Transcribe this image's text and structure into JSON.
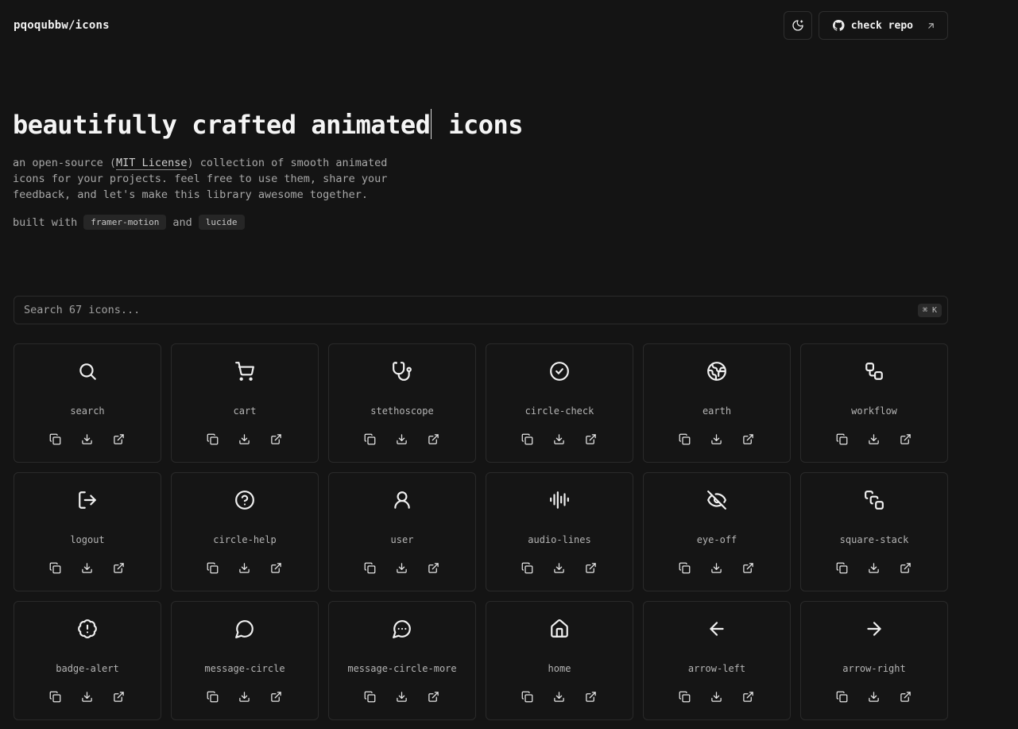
{
  "header": {
    "brand": "pqoqubbw/icons",
    "theme_toggle_icon": "moon-sun-icon",
    "repo_button_label": "check repo"
  },
  "hero": {
    "title_before_caret": "beautifully crafted animated",
    "title_after_caret": " icons",
    "desc_part1": "an open-source (",
    "license_link": "MIT License",
    "desc_part2": ") collection of smooth animated icons for your projects. feel free to use them, share your feedback, and let's make this library awesome together.",
    "built_with_label": "built with",
    "and_label": "and",
    "libraries": [
      "framer-motion",
      "lucide"
    ]
  },
  "search": {
    "placeholder": "Search 67 icons...",
    "shortcut": "⌘ K"
  },
  "icons": [
    {
      "name": "search",
      "icon": "search"
    },
    {
      "name": "cart",
      "icon": "cart"
    },
    {
      "name": "stethoscope",
      "icon": "stethoscope"
    },
    {
      "name": "circle-check",
      "icon": "circle-check"
    },
    {
      "name": "earth",
      "icon": "earth"
    },
    {
      "name": "workflow",
      "icon": "workflow"
    },
    {
      "name": "logout",
      "icon": "logout"
    },
    {
      "name": "circle-help",
      "icon": "circle-help"
    },
    {
      "name": "user",
      "icon": "user"
    },
    {
      "name": "audio-lines",
      "icon": "audio-lines"
    },
    {
      "name": "eye-off",
      "icon": "eye-off"
    },
    {
      "name": "square-stack",
      "icon": "square-stack"
    },
    {
      "name": "badge-alert",
      "icon": "badge-alert"
    },
    {
      "name": "message-circle",
      "icon": "message-circle"
    },
    {
      "name": "message-circle-more",
      "icon": "message-circle-more"
    },
    {
      "name": "home",
      "icon": "home"
    },
    {
      "name": "arrow-left",
      "icon": "arrow-left"
    },
    {
      "name": "arrow-right",
      "icon": "arrow-right"
    }
  ],
  "card_actions": [
    "copy-icon",
    "download-icon",
    "external-link-icon"
  ],
  "colors": {
    "background": "#141414",
    "card_border": "#2a2a2a",
    "text": "#ededed",
    "muted_text": "#a8a8a8"
  }
}
